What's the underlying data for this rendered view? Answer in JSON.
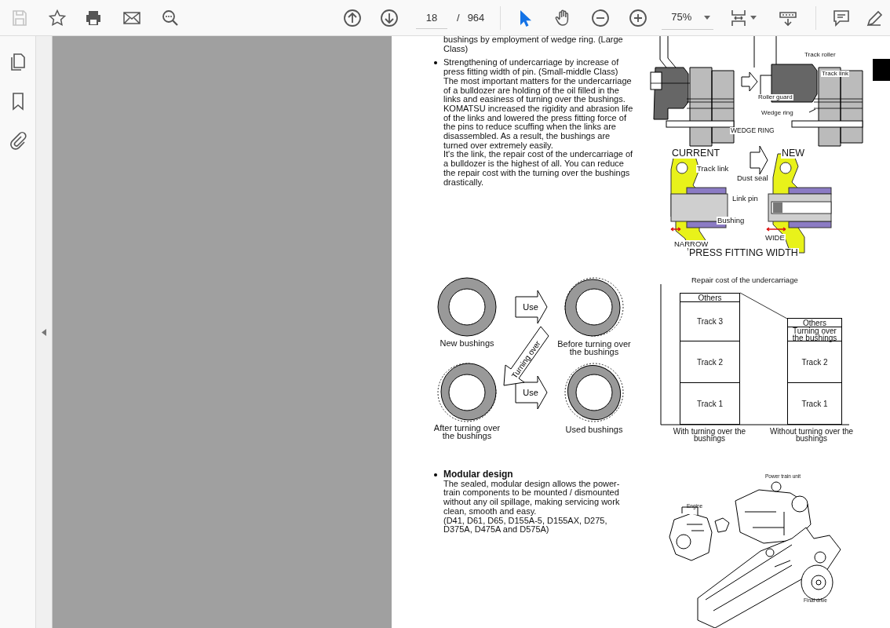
{
  "toolbar": {
    "page_number": "18",
    "page_separator": "/",
    "page_count": "964",
    "zoom": "75%",
    "tools": [
      {
        "kind": "select",
        "selected": true
      },
      {
        "kind": "hand",
        "selected": false
      }
    ]
  },
  "document": {
    "continued_text": "bushings by employment of wedge ring. (Large Class)",
    "sections": [
      {
        "heading": "Strengthening of undercarriage by increase of press fitting width of pin. (Small-middle Class)",
        "heading_bold": false,
        "paragraphs": [
          "The most important matters for the undercarriage of a bulldozer are holding of the oil filled in the links and easiness of turning over the bushings. KOMATSU increased the rigidity and abrasion life of the links and lowered the press fitting force of the pins to reduce scuffing when the links are disassembled.  As a result, the bushings are turned over extremely easily.",
          "It's the link, the repair cost of the undercarriage of a bulldozer is the highest of all.  You can reduce the repair cost with the turning over the bushings drastically."
        ]
      },
      {
        "heading": "Modular design",
        "heading_bold": true,
        "paragraphs": [
          "The sealed, modular design allows the power-train components to be mounted / dismounted without any oil spillage, making servicing work clean, smooth and easy.",
          "(D41, D61, D65, D155A-5, D155AX, D275, D375A, D475A and D575A)"
        ]
      }
    ],
    "wedge_ring_figure": {
      "labels": [
        "Track roller",
        "Track link",
        "Roller guard",
        "Wedge ring"
      ],
      "caption": "WEDGE RING"
    },
    "press_fit_figure": {
      "current": "CURRENT",
      "new": "NEW",
      "labels": [
        "Track link",
        "Dust seal",
        "Link pin",
        "Bushing"
      ],
      "narrow": "NARROW",
      "wide": "WIDE",
      "caption": "PRESS FITTING WIDTH"
    },
    "bushing_figure": {
      "states": [
        "New bushings",
        "Before turning over the bushings",
        "After turning over the bushings",
        "Used bushings"
      ],
      "use_arrows": [
        "Use",
        "Use"
      ],
      "turn_arrow": "Turning over"
    },
    "cost_figure": {
      "title": "Repair cost of the undercarriage",
      "bars": [
        {
          "label": "With turning over the bushings",
          "segments": [
            "Others",
            "Track 3",
            "Track 2",
            "Track 1"
          ]
        },
        {
          "label": "Without turning over the bushings",
          "segments": [
            "Others",
            "Turning over the bushings",
            "Track 2",
            "Track 1"
          ]
        }
      ]
    },
    "machine_figure": {
      "labels": [
        "Power train unit",
        "Engine",
        "Final drive"
      ]
    }
  }
}
